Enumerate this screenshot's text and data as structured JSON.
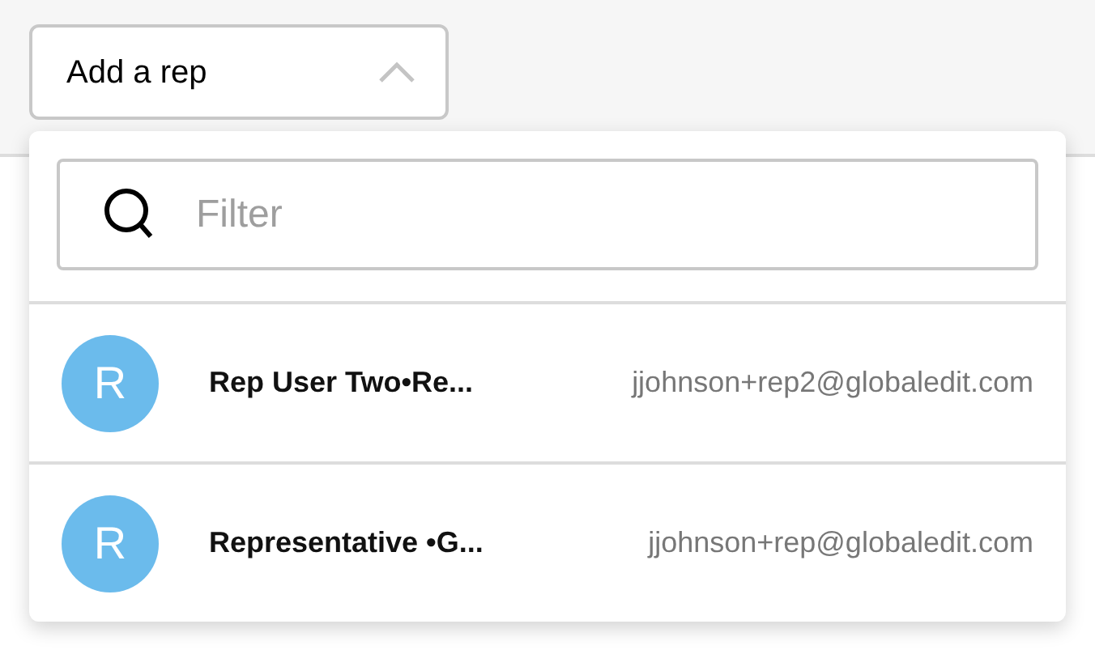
{
  "rep_dropdown": {
    "label": "Add a rep",
    "expanded": true
  },
  "filter": {
    "placeholder": "Filter"
  },
  "reps": [
    {
      "initial": "R",
      "color": "#6bbbec",
      "name": "Rep User Two•Re...",
      "email": "jjohnson+rep2@globaledit.com"
    },
    {
      "initial": "R",
      "color": "#6bbbec",
      "name": "Representative •G...",
      "email": "jjohnson+rep@globaledit.com"
    }
  ]
}
